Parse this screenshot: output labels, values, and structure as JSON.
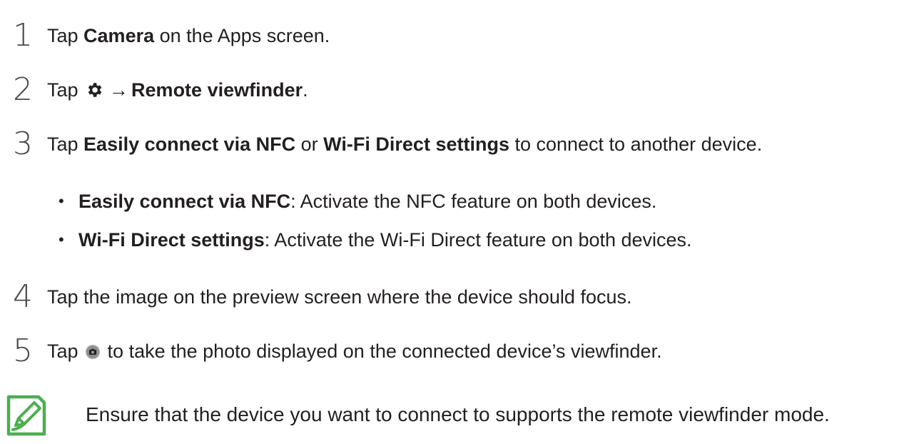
{
  "steps": [
    {
      "number": "1",
      "parts": [
        "Tap ",
        "Camera",
        " on the Apps screen."
      ]
    },
    {
      "number": "2",
      "parts": [
        "Tap ",
        "→",
        "Remote viewfinder",
        "."
      ]
    },
    {
      "number": "3",
      "parts": [
        "Tap ",
        "Easily connect via NFC",
        " or ",
        "Wi-Fi Direct settings",
        " to connect to another device."
      ],
      "bullets": [
        {
          "bullet": "•",
          "term": "Easily connect via NFC",
          "desc": ": Activate the NFC feature on both devices."
        },
        {
          "bullet": "•",
          "term": "Wi-Fi Direct settings",
          "desc": ": Activate the Wi-Fi Direct feature on both devices."
        }
      ]
    },
    {
      "number": "4",
      "parts": [
        "Tap the image on the preview screen where the device should focus."
      ]
    },
    {
      "number": "5",
      "parts": [
        "Tap ",
        " to take the photo displayed on the connected device’s viewfinder."
      ]
    }
  ],
  "note": {
    "text": "Ensure that the device you want to connect to supports the remote viewfinder mode."
  },
  "icons": {
    "settings": "gear-icon",
    "capture": "camera-button-icon",
    "note": "note-pencil-icon"
  },
  "colors": {
    "text": "#231f20",
    "note_icon": "#4caf50",
    "camera_button": "#9e9e9e"
  }
}
